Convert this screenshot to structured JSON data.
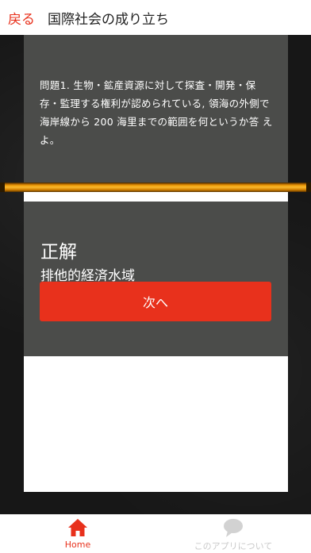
{
  "header": {
    "back_label": "戻る",
    "title": "国際社会の成り立ち"
  },
  "quiz": {
    "question": "問題1. 生物・鉱産資源に対して探査・開発・保存・監理する権利が認められている, 領海の外側で海岸線から 200 海里までの範囲を何というか答 えよ。",
    "result_label": "正解",
    "answer": "排他的経済水域",
    "next_label": "次へ"
  },
  "tabbar": {
    "home_label": "Home",
    "about_label": "このアプリについて"
  },
  "colors": {
    "accent": "#e8311c",
    "panel": "#4b4c4a",
    "inactive": "#c9c9c9"
  }
}
